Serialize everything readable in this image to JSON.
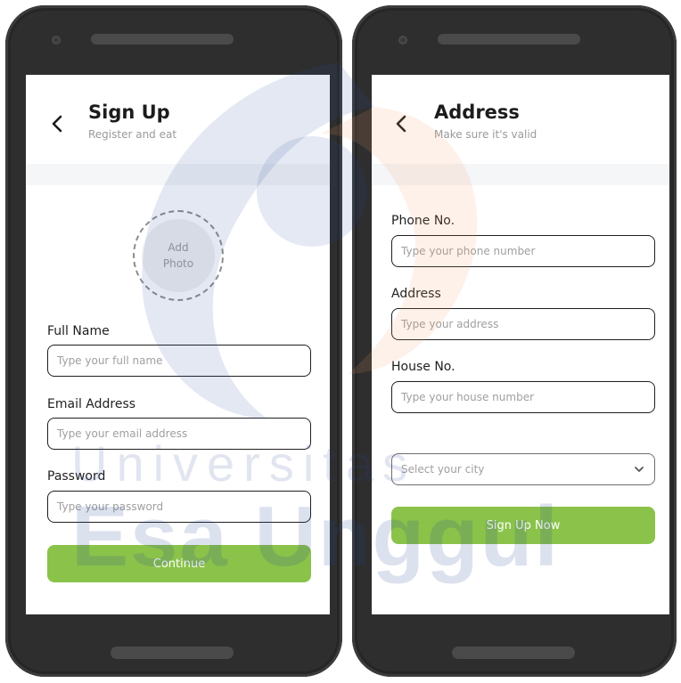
{
  "colors": {
    "accent": "#8bc34a",
    "phone_body": "#2e2e2e",
    "watermark_blue": "#2a4a9a",
    "watermark_orange": "#f39b6b"
  },
  "signup": {
    "title": "Sign Up",
    "subtitle": "Register and eat",
    "photo_label_line1": "Add",
    "photo_label_line2": "Photo",
    "fields": [
      {
        "label": "Full Name",
        "placeholder": "Type your full name"
      },
      {
        "label": "Email Address",
        "placeholder": "Type your email address"
      },
      {
        "label": "Password",
        "placeholder": "Type your password"
      }
    ],
    "button_label": "Continue"
  },
  "address": {
    "title": "Address",
    "subtitle": "Make sure it's valid",
    "fields": [
      {
        "label": "Phone No.",
        "placeholder": "Type your phone number"
      },
      {
        "label": "Address",
        "placeholder": "Type your address"
      },
      {
        "label": "House No.",
        "placeholder": "Type your house number"
      }
    ],
    "city_select": "Select your city",
    "button_label": "Sign Up Now"
  },
  "watermark": {
    "line1": "Universitas",
    "line2": "Esa Unggul"
  }
}
